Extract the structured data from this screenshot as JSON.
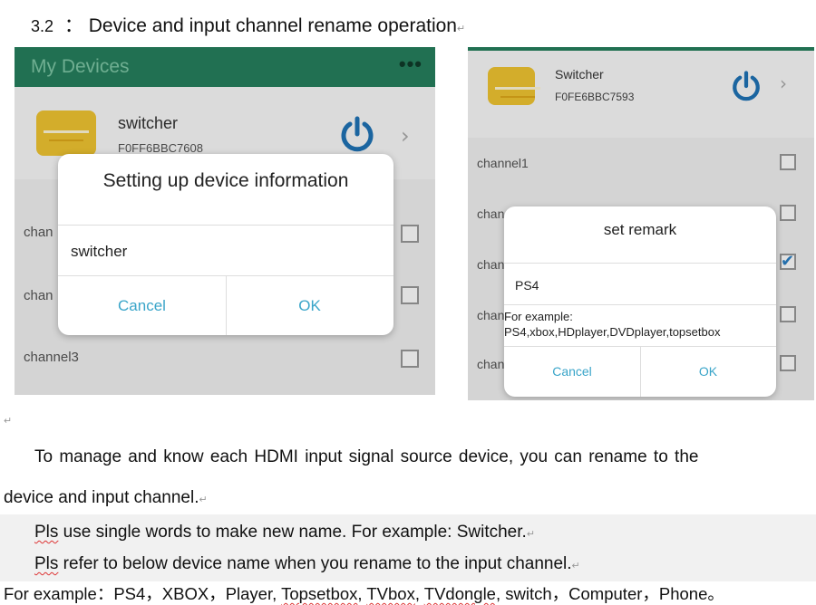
{
  "heading": {
    "number": "3.2",
    "separator": "：",
    "title": "Device and input channel rename operation"
  },
  "screenshot_left": {
    "app_title": "My Devices",
    "menu": "•••",
    "device": {
      "name": "switcher",
      "id": "F0FF6BBC7608"
    },
    "channels": [
      "chan",
      "chan",
      "channel3"
    ],
    "dialog": {
      "title": "Setting up device information",
      "input_value": "switcher",
      "cancel": "Cancel",
      "ok": "OK"
    }
  },
  "screenshot_right": {
    "device": {
      "name": "Switcher",
      "id": "F0FE6BBC7593"
    },
    "channels": [
      "channel1",
      "chan",
      "chan",
      "chan",
      "chan"
    ],
    "checked_channel_index": 2,
    "dialog": {
      "title": "set remark",
      "input_value": "PS4",
      "hint_line1": "For example:",
      "hint_line2": "PS4,xbox,HDplayer,DVDplayer,topsetbox",
      "cancel": "Cancel",
      "ok": "OK"
    }
  },
  "body": {
    "para_line1": "To manage and know each HDMI input signal source device, you can rename to the",
    "para_line2": "device and input channel.",
    "tip1_pre": "Pls",
    "tip1_rest": " use single words to make new name. For example: Switcher.",
    "tip2_pre": "Pls",
    "tip2_rest": " refer to below device name when you rename to the input channel.",
    "example_prefix": "For example：PS4，XBOX，Player, ",
    "example_w1": "Topsetbox",
    "example_sep1": ", ",
    "example_w2": "TVbox",
    "example_sep2": ", ",
    "example_w3": "TVdongle",
    "example_suffix": ", switch，Computer，Phone。"
  }
}
